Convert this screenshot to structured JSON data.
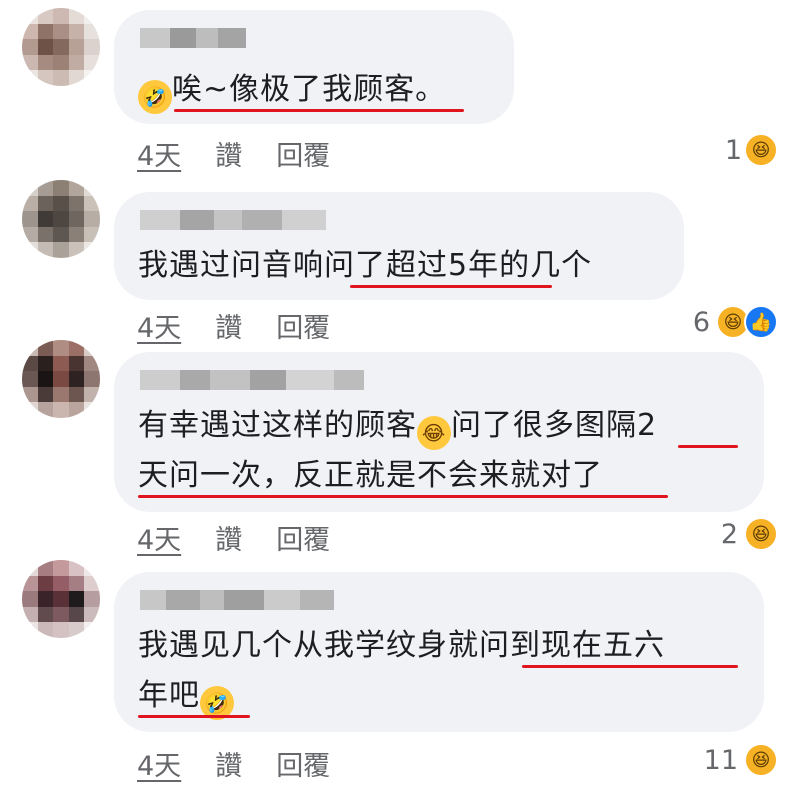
{
  "comments": [
    {
      "line1": "唉~像极了我顾客。",
      "time": "4天",
      "like": "讚",
      "reply": "回覆",
      "count": "1",
      "reaction_icons": [
        "haha"
      ]
    },
    {
      "line1": "我遇过问音响问了超过5年的几个",
      "time": "4天",
      "like": "讚",
      "reply": "回覆",
      "count": "6",
      "reaction_icons": [
        "haha",
        "like"
      ]
    },
    {
      "line1": "有幸遇过这样的顾客",
      "line1b": "问了很多图隔2",
      "line2": "天问一次，反正就是不会来就对了",
      "time": "4天",
      "like": "讚",
      "reply": "回覆",
      "count": "2",
      "reaction_icons": [
        "haha"
      ]
    },
    {
      "line1": "我遇见几个从我学纹身就问到现在五六",
      "line2": "年吧",
      "time": "4天",
      "like": "讚",
      "reply": "回覆",
      "count": "11",
      "reaction_icons": [
        "haha"
      ]
    }
  ],
  "colors": {
    "bubble": "#f0f2f5",
    "underline": "#e0141e",
    "meta": "#65676b",
    "like_blue": "#1877f2"
  },
  "icons": {
    "emoji_rofl": "rofl-emoji-icon",
    "emoji_joy": "joy-emoji-icon",
    "haha": "haha-reaction-icon",
    "like": "like-reaction-icon"
  }
}
